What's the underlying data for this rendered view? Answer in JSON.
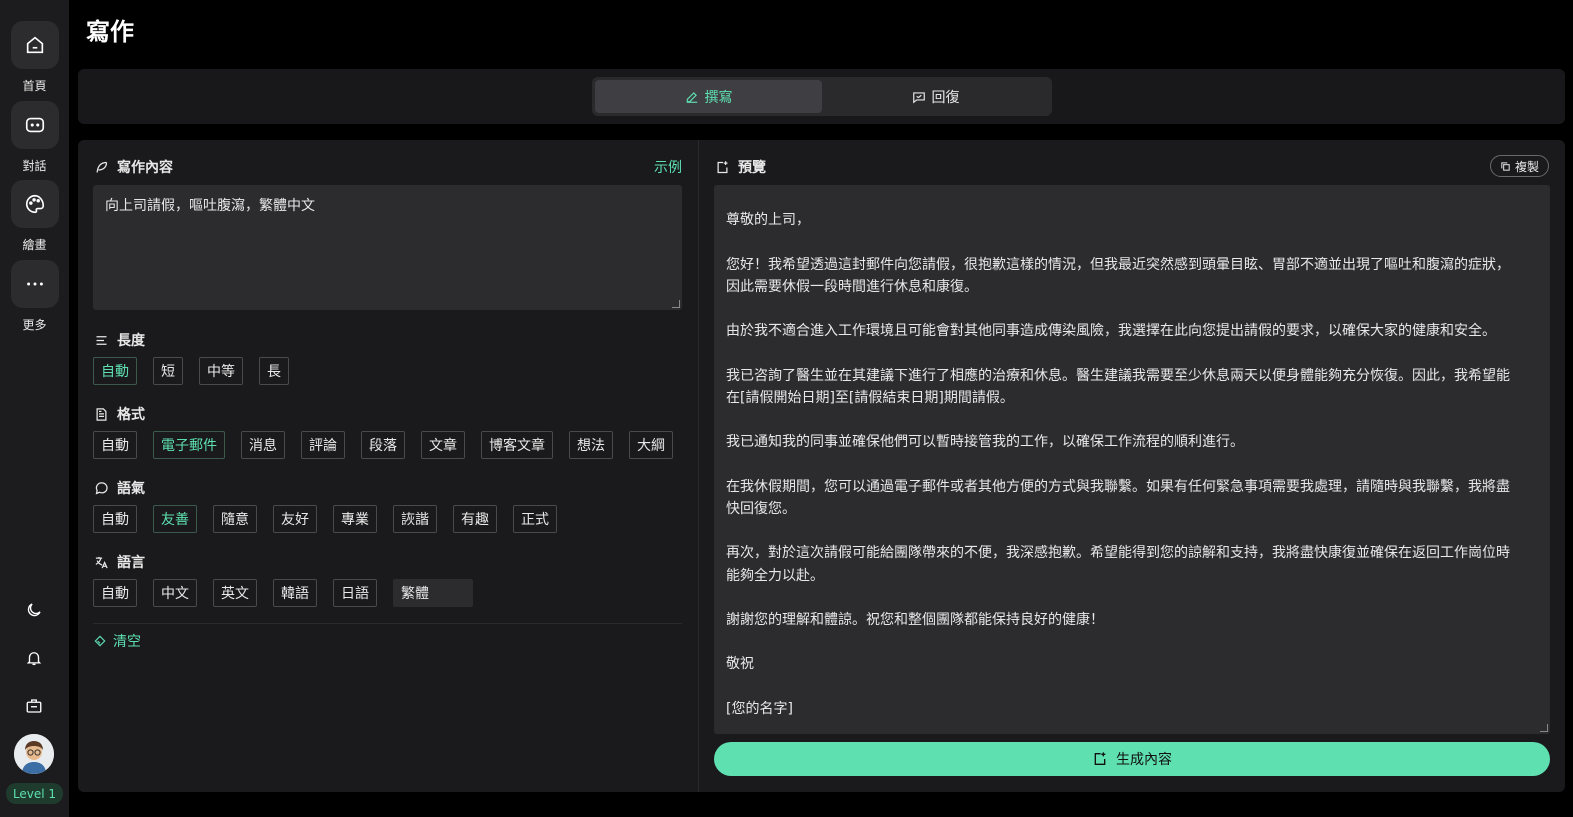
{
  "sidebar": {
    "items": [
      {
        "label": "首頁",
        "icon": "home-icon"
      },
      {
        "label": "對話",
        "icon": "chat-icon"
      },
      {
        "label": "繪畫",
        "icon": "palette-icon"
      },
      {
        "label": "更多",
        "icon": "more-icon"
      }
    ],
    "level": "Level 1"
  },
  "page": {
    "title": "寫作"
  },
  "tabs": {
    "compose": "撰寫",
    "reply": "回復"
  },
  "left": {
    "content_title": "寫作內容",
    "example_link": "示例",
    "input_value": "向上司請假，嘔吐腹瀉，繁體中文",
    "length": {
      "title": "長度",
      "options": [
        "自動",
        "短",
        "中等",
        "長"
      ],
      "selected": "自動"
    },
    "format": {
      "title": "格式",
      "options": [
        "自動",
        "電子郵件",
        "消息",
        "評論",
        "段落",
        "文章",
        "博客文章",
        "想法",
        "大綱"
      ],
      "selected": "電子郵件"
    },
    "tone": {
      "title": "語氣",
      "options": [
        "自動",
        "友善",
        "隨意",
        "友好",
        "專業",
        "詼諧",
        "有趣",
        "正式"
      ],
      "selected": "友善"
    },
    "language": {
      "title": "語言",
      "options": [
        "自動",
        "中文",
        "英文",
        "韓語",
        "日語"
      ],
      "custom_value": "繁體"
    },
    "clear": "清空"
  },
  "right": {
    "preview_title": "預覽",
    "copy": "複製",
    "preview_text": "主題：向上司請假，嘔吐腹瀉\n\n尊敬的上司，\n\n您好！我希望透過這封郵件向您請假，很抱歉這樣的情況，但我最近突然感到頭暈目眩、胃部不適並出現了嘔吐和腹瀉的症狀，\n因此需要休假一段時間進行休息和康復。\n\n由於我不適合進入工作環境且可能會對其他同事造成傳染風險，我選擇在此向您提出請假的要求，以確保大家的健康和安全。\n\n我已咨詢了醫生並在其建議下進行了相應的治療和休息。醫生建議我需要至少休息兩天以便身體能夠充分恢復。因此，我希望能\n在[請假開始日期]至[請假結束日期]期間請假。\n\n我已通知我的同事並確保他們可以暫時接管我的工作，以確保工作流程的順利進行。\n\n在我休假期間，您可以通過電子郵件或者其他方便的方式與我聯繫。如果有任何緊急事項需要我處理，請隨時與我聯繫，我將盡\n快回復您。\n\n再次，對於這次請假可能給團隊帶來的不便，我深感抱歉。希望能得到您的諒解和支持，我將盡快康復並確保在返回工作崗位時\n能夠全力以赴。\n\n謝謝您的理解和體諒。祝您和整個團隊都能保持良好的健康！\n\n敬祝\n\n[您的名字]",
    "generate": "生成內容"
  },
  "colors": {
    "accent": "#5ee0b1",
    "panel": "#1a1a1c",
    "input": "#2c2c2f"
  }
}
